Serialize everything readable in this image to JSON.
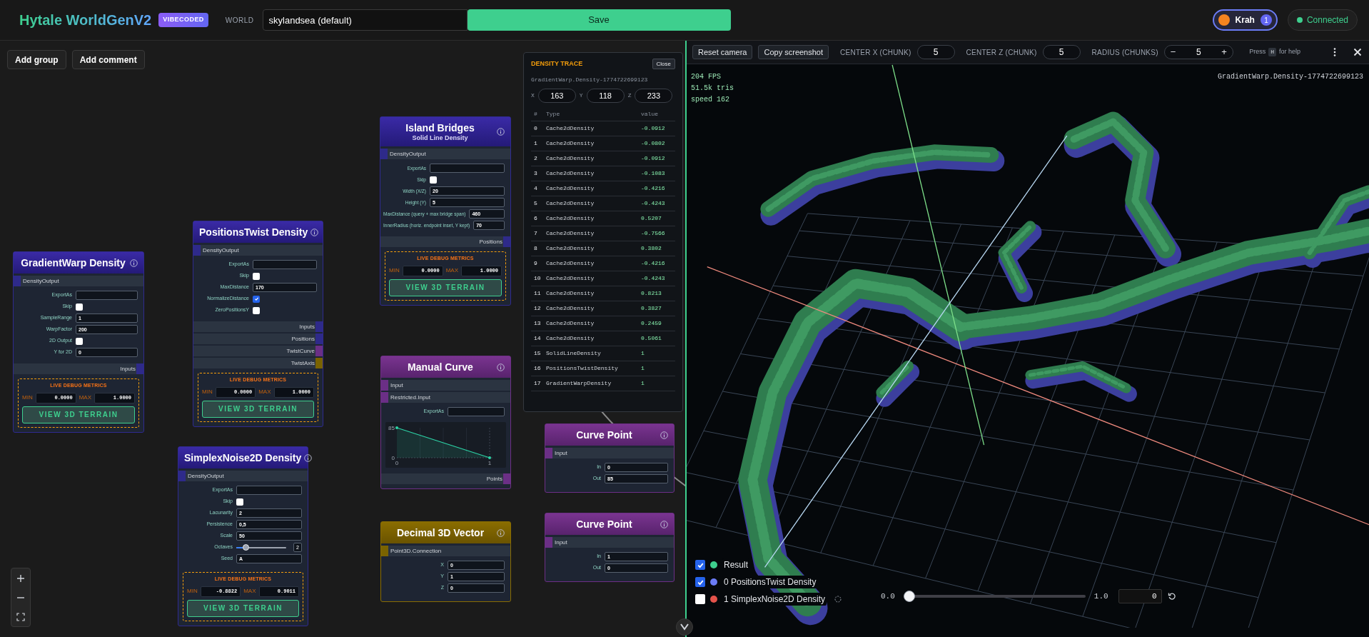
{
  "header": {
    "title": "Hytale WorldGenV2",
    "badge": "VIBECODED",
    "world_label": "WORLD",
    "world_value": "skylandsea (default)",
    "save": "Save",
    "user": {
      "name": "Krah",
      "count": "1"
    },
    "connection": {
      "label": "Connected",
      "connected": true
    }
  },
  "canvas_toolbar": [
    "Add group",
    "Add comment"
  ],
  "nodes": [
    {
      "title": "GradientWarp Density",
      "kind": "density",
      "rows": [
        {
          "kind": "port_in",
          "label": "DensityOutput",
          "color": "#2e2a8a"
        },
        {
          "kind": "field",
          "label": "ExportAs"
        },
        {
          "kind": "checkbox",
          "label": "Skip",
          "checked": false
        },
        {
          "kind": "field",
          "label": "SampleRange",
          "value": "1"
        },
        {
          "kind": "field",
          "label": "WarpFactor",
          "value": "200"
        },
        {
          "kind": "checkbox",
          "label": "2D Output",
          "checked": false
        },
        {
          "kind": "field",
          "label": "Y for 2D",
          "value": "0"
        },
        {
          "kind": "port_out",
          "label": "Inputs",
          "color": "#2e2a8a"
        },
        {
          "kind": "metrics",
          "title": "LIVE DEBUG METRICS",
          "min_label": "MIN",
          "min": "0.0000",
          "max_label": "MAX",
          "max": "1.0000",
          "button": "VIEW 3D TERRAIN"
        }
      ]
    },
    {
      "title": "PositionsTwist Density",
      "kind": "density",
      "rows": [
        {
          "kind": "port_in",
          "label": "DensityOutput",
          "color": "#2e2a8a"
        },
        {
          "kind": "field",
          "label": "ExportAs"
        },
        {
          "kind": "checkbox",
          "label": "Skip",
          "checked": false
        },
        {
          "kind": "field",
          "label": "MaxDistance",
          "value": "170"
        },
        {
          "kind": "checkbox",
          "label": "NormalizeDistance",
          "checked": true
        },
        {
          "kind": "checkbox",
          "label": "ZeroPositionsY",
          "checked": false
        },
        {
          "kind": "port_out",
          "label": "Inputs",
          "color": "#2e2a8a"
        },
        {
          "kind": "port_out",
          "label": "Positions",
          "color": "#2e2a8a"
        },
        {
          "kind": "port_out",
          "label": "TwistCurve",
          "color": "#6b2f86"
        },
        {
          "kind": "port_out",
          "label": "TwistAxis",
          "color": "#7a6300"
        },
        {
          "kind": "metrics",
          "title": "LIVE DEBUG METRICS",
          "min_label": "MIN",
          "min": "0.0000",
          "max_label": "MAX",
          "max": "1.0000",
          "button": "VIEW 3D TERRAIN"
        }
      ]
    },
    {
      "title": "Island Bridges",
      "subtitle": "Solid Line Density",
      "kind": "density",
      "rows": [
        {
          "kind": "port_in",
          "label": "DensityOutput",
          "color": "#2e2a8a"
        },
        {
          "kind": "field",
          "label": "ExportAs"
        },
        {
          "kind": "checkbox",
          "label": "Skip",
          "checked": false
        },
        {
          "kind": "field",
          "label": "Width (X/Z)",
          "value": "20"
        },
        {
          "kind": "field",
          "label": "Height (Y)",
          "value": "5"
        },
        {
          "kind": "field",
          "label": "MaxDistance (query + max bridge span)",
          "value": "460"
        },
        {
          "kind": "field",
          "label": "InnerRadius (horiz. endpoint inset, Y kept)",
          "value": "70"
        },
        {
          "kind": "port_out",
          "label": "Positions",
          "color": "#2e2a8a"
        },
        {
          "kind": "metrics",
          "title": "LIVE DEBUG METRICS",
          "min_label": "MIN",
          "min": "0.0000",
          "max_label": "MAX",
          "max": "1.0000",
          "button": "VIEW 3D TERRAIN"
        }
      ]
    },
    {
      "title": "SimplexNoise2D Density",
      "kind": "density",
      "rows": [
        {
          "kind": "port_in",
          "label": "DensityOutput",
          "color": "#2e2a8a"
        },
        {
          "kind": "field",
          "label": "ExportAs"
        },
        {
          "kind": "checkbox",
          "label": "Skip",
          "checked": false
        },
        {
          "kind": "field",
          "label": "Lacunarity",
          "value": "2"
        },
        {
          "kind": "field",
          "label": "Persistence",
          "value": "0,5"
        },
        {
          "kind": "field",
          "label": "Scale",
          "value": "50"
        },
        {
          "kind": "slider",
          "label": "Octaves",
          "level": 0.15,
          "value": "2"
        },
        {
          "kind": "field",
          "label": "Seed",
          "value": "A"
        },
        {
          "kind": "metrics",
          "title": "LIVE DEBUG METRICS",
          "min_label": "MIN",
          "min": "-0.8822",
          "max_label": "MAX",
          "max": "0.9011",
          "button": "VIEW 3D TERRAIN"
        }
      ]
    },
    {
      "title": "Manual Curve",
      "kind": "curve",
      "rows": [
        {
          "kind": "port_in",
          "label": "Input",
          "color": "#6b2f86"
        },
        {
          "kind": "port_in",
          "label": "Restricted.Input",
          "color": "#6b2f86"
        },
        {
          "kind": "field",
          "label": "ExportAs"
        },
        {
          "kind": "chart",
          "chart_data": {
            "type": "area",
            "x": [
              0,
              1
            ],
            "values": [
              85,
              0
            ],
            "xlim": [
              0,
              1
            ],
            "ylim": [
              0,
              85
            ],
            "xticks": [
              0,
              1
            ],
            "yticks": [
              0,
              85
            ]
          }
        },
        {
          "kind": "port_out",
          "label": "Points",
          "color": "#6b2f86"
        }
      ]
    },
    {
      "title": "Decimal 3D Vector",
      "kind": "vector",
      "rows": [
        {
          "kind": "port_in",
          "label": "Point3D.Connection",
          "color": "#7a6300"
        },
        {
          "kind": "field",
          "label": "X",
          "value": "0"
        },
        {
          "kind": "field",
          "label": "Y",
          "value": "1"
        },
        {
          "kind": "field",
          "label": "Z",
          "value": "0"
        }
      ]
    },
    {
      "title": "Curve Point",
      "kind": "curve",
      "rows": [
        {
          "kind": "port_in",
          "label": "Input",
          "color": "#6b2f86"
        },
        {
          "kind": "field",
          "label": "In",
          "value": "0"
        },
        {
          "kind": "field",
          "label": "Out",
          "value": "85"
        }
      ]
    },
    {
      "title": "Curve Point",
      "kind": "curve",
      "rows": [
        {
          "kind": "port_in",
          "label": "Input",
          "color": "#6b2f86"
        },
        {
          "kind": "field",
          "label": "In",
          "value": "1"
        },
        {
          "kind": "field",
          "label": "Out",
          "value": "0"
        }
      ]
    }
  ],
  "density_trace": {
    "title": "DENSITY TRACE",
    "close": "Close",
    "node_id": "GradientWarp.Density-1774722699123",
    "coords": [
      {
        "axis": "X",
        "value": "163"
      },
      {
        "axis": "Y",
        "value": "118"
      },
      {
        "axis": "Z",
        "value": "233"
      }
    ],
    "columns": [
      "#",
      "Type",
      "value"
    ],
    "rows": [
      {
        "index": "0",
        "type": "Cache2dDensity",
        "value": "-0.0912"
      },
      {
        "index": "1",
        "type": "Cache2dDensity",
        "value": "-0.0802"
      },
      {
        "index": "2",
        "type": "Cache2dDensity",
        "value": "-0.0912"
      },
      {
        "index": "3",
        "type": "Cache2dDensity",
        "value": "-0.1083"
      },
      {
        "index": "4",
        "type": "Cache2dDensity",
        "value": "-0.4216"
      },
      {
        "index": "5",
        "type": "Cache2dDensity",
        "value": "-0.4243"
      },
      {
        "index": "6",
        "type": "Cache2dDensity",
        "value": "0.5207"
      },
      {
        "index": "7",
        "type": "Cache2dDensity",
        "value": "-0.7566"
      },
      {
        "index": "8",
        "type": "Cache2dDensity",
        "value": "0.3802"
      },
      {
        "index": "9",
        "type": "Cache2dDensity",
        "value": "-0.4216"
      },
      {
        "index": "10",
        "type": "Cache2dDensity",
        "value": "-0.4243"
      },
      {
        "index": "11",
        "type": "Cache2dDensity",
        "value": "0.8213"
      },
      {
        "index": "12",
        "type": "Cache2dDensity",
        "value": "0.3827"
      },
      {
        "index": "13",
        "type": "Cache2dDensity",
        "value": "0.2459"
      },
      {
        "index": "14",
        "type": "Cache2dDensity",
        "value": "0.5061"
      },
      {
        "index": "15",
        "type": "SolidLineDensity",
        "value": "1"
      },
      {
        "index": "16",
        "type": "PositionsTwistDensity",
        "value": "1"
      },
      {
        "index": "17",
        "type": "GradientWarpDensity",
        "value": "1"
      }
    ]
  },
  "viewer": {
    "toolbar": {
      "reset": "Reset camera",
      "copy": "Copy screenshot",
      "center_x": {
        "label": "CENTER X (CHUNK)",
        "value": "5"
      },
      "center_z": {
        "label": "CENTER Z (CHUNK)",
        "value": "5"
      },
      "radius": {
        "label": "RADIUS (CHUNKS)",
        "minus": "−",
        "value": "5",
        "plus": "+"
      },
      "help": {
        "before": "Press",
        "key": "H",
        "after": "for help"
      }
    },
    "stats": [
      "204 FPS",
      "51.5k tris",
      "speed 162"
    ],
    "node_id": "GradientWarp.Density-1774722699123",
    "layers": [
      {
        "label": "Result",
        "checked": true,
        "color": "#3ecf8e",
        "loading": false
      },
      {
        "label": "0 PositionsTwist Density",
        "checked": true,
        "color": "#6b7cf5",
        "loading": false
      },
      {
        "label": "1 SimplexNoise2D Density",
        "checked": false,
        "color": "#e5534b",
        "loading": true
      }
    ],
    "slider": {
      "min": "0.0",
      "max": "1.0",
      "level": 0,
      "value": "0"
    }
  }
}
